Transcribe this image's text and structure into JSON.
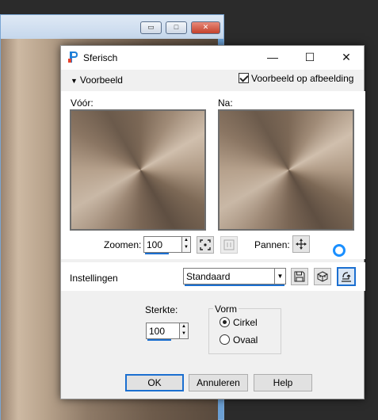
{
  "background_window": {
    "controls": {
      "minimize": "▭",
      "maximize": "□",
      "close": "✕"
    }
  },
  "dialog": {
    "title": "Sferisch",
    "title_controls": {
      "minimize": "—",
      "maximize": "☐",
      "close": "✕"
    },
    "preview_toggle_label": "Voorbeeld",
    "preview_on_image_label": "Voorbeeld op afbeelding",
    "preview_on_image_checked": true,
    "before_label": "Vóór:",
    "after_label": "Na:",
    "zoom_label": "Zoomen:",
    "zoom_value": "100",
    "pan_label": "Pannen:",
    "settings_label": "Instellingen",
    "settings_value": "Standaard",
    "strength_label": "Sterkte:",
    "strength_value": "100",
    "shape_group_label": "Vorm",
    "shape_options": [
      "Cirkel",
      "Ovaal"
    ],
    "shape_selected": "Cirkel",
    "buttons": {
      "ok": "OK",
      "cancel": "Annuleren",
      "help": "Help"
    },
    "icons": {
      "zoom_fit": "zoom-fit-icon",
      "zoom_actual": "zoom-actual-size-icon",
      "pan": "move-icon",
      "save_preset": "save-icon",
      "random": "randomize-icon",
      "reset": "reset-icon"
    },
    "colors": {
      "accent": "#1b6fd0",
      "busy_indicator": "#1a8fff"
    }
  }
}
